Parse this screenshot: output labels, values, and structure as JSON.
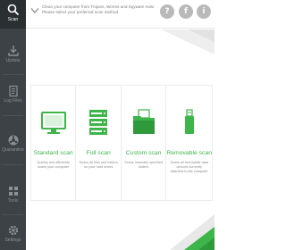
{
  "sidebar": {
    "items": [
      {
        "label": "Scan",
        "icon": "search-icon",
        "active": true
      },
      {
        "label": "Update",
        "icon": "download-icon",
        "active": false
      },
      {
        "label": "Log Files",
        "icon": "log-files-icon",
        "active": false
      },
      {
        "label": "Quarantine",
        "icon": "quarantine-icon",
        "active": false
      },
      {
        "label": "Tools",
        "icon": "tools-icon",
        "active": false
      },
      {
        "label": "Settings",
        "icon": "gear-icon",
        "active": false
      }
    ]
  },
  "header": {
    "message": "Clean your computer from Trojans, Worms and Spyware now! Please select your preferred scan method.",
    "help_label": "?",
    "facebook_label": "f",
    "info_label": "i"
  },
  "scans": [
    {
      "title": "Standard scan",
      "description": "Quickly and efficiently scans your computer",
      "icon": "monitor-icon"
    },
    {
      "title": "Full scan",
      "description": "Scans all files and folders on your hard drives",
      "icon": "hard-drives-icon"
    },
    {
      "title": "Custom scan",
      "description": "Scans manually specified folders",
      "icon": "folder-icon"
    },
    {
      "title": "Removable scan",
      "description": "Scans all removable data devices currently attached to the computer",
      "icon": "usb-drive-icon"
    }
  ],
  "colors": {
    "accent": "#3db54a",
    "sidebar_bg": "#3c4245",
    "sidebar_active_bg": "#2a2f31"
  }
}
